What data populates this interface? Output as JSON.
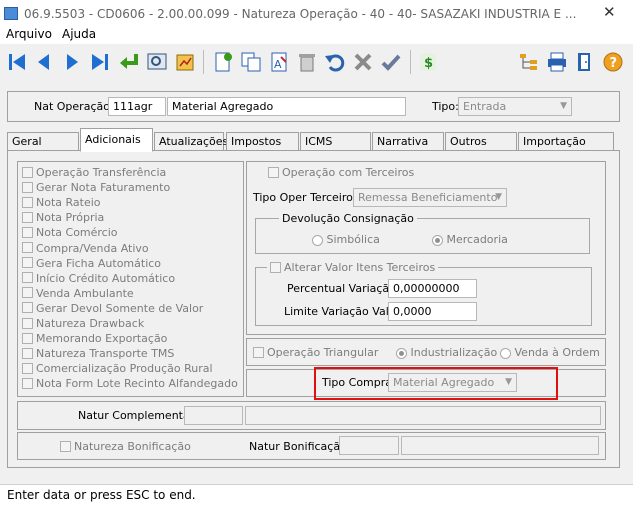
{
  "window": {
    "title": "06.9.5503 - CD0606 - 2.00.00.099 - Natureza Operação - 40 - 40- SASAZAKI INDUSTRIA E ..."
  },
  "menu": {
    "arquivo": "Arquivo",
    "ajuda": "Ajuda"
  },
  "toolbar": {
    "icons": [
      "first-icon",
      "prev-icon",
      "next-icon",
      "last-icon",
      "return-icon",
      "search-icon",
      "report-icon",
      "new-icon",
      "copy-icon",
      "text-icon",
      "delete-icon",
      "undo-icon",
      "cancel-icon",
      "confirm-icon",
      "money-icon",
      "tree-icon",
      "print-icon",
      "exit-icon",
      "help-icon"
    ]
  },
  "header": {
    "nat_operacao_label": "Nat Operação:",
    "nat_operacao_code": "111agr",
    "nat_operacao_desc": "Material Agregado",
    "tipo_label": "Tipo:",
    "tipo_value": "Entrada"
  },
  "tabs": [
    "Geral",
    "Adicionais",
    "Atualizações",
    "Impostos",
    "ICMS",
    "Narrativa",
    "Outros",
    "Importação"
  ],
  "left_checkboxes": [
    "Operação Transferência",
    "Gerar Nota Faturamento",
    "Nota Rateio",
    "Nota Própria",
    "Nota Comércio",
    "Compra/Venda Ativo",
    "Gera Ficha Automático",
    "Início Crédito Automático",
    "Venda Ambulante",
    "Gerar Devol Somente de Valor",
    "Natureza Drawback",
    "Memorando Exportação",
    "Natureza Transporte TMS",
    "Comercialização Produção Rural",
    "Nota Form Lote Recinto Alfandegado"
  ],
  "terceiros": {
    "operacao_com_terceiros": "Operação com Terceiros",
    "tipo_oper_label": "Tipo Oper Terceiros:",
    "tipo_oper_value": "Remessa Beneficiamento",
    "devolucao_title": "Devolução Consignação",
    "radio_simbolica": "Simbólica",
    "radio_mercadoria": "Mercadoria"
  },
  "alterar": {
    "checkbox_label": "Alterar Valor Itens Terceiros",
    "percentual_label": "Percentual Variação:",
    "percentual_value": "0,00000000",
    "limite_label": "Limite Variação Valor:",
    "limite_value": "0,0000"
  },
  "triangular": {
    "checkbox_label": "Operação Triangular",
    "radio_industrializacao": "Industrialização",
    "radio_venda": "Venda à Ordem"
  },
  "tipo_compra": {
    "label": "Tipo Compra:",
    "value": "Material Agregado",
    "highlight_color": "#e01010"
  },
  "natur_complementar": {
    "label": "Natur Complementar:"
  },
  "bonificacao": {
    "checkbox_label": "Natureza Bonificação",
    "natur_label": "Natur Bonificação:"
  },
  "status": {
    "text": "Enter data or press ESC to end."
  }
}
